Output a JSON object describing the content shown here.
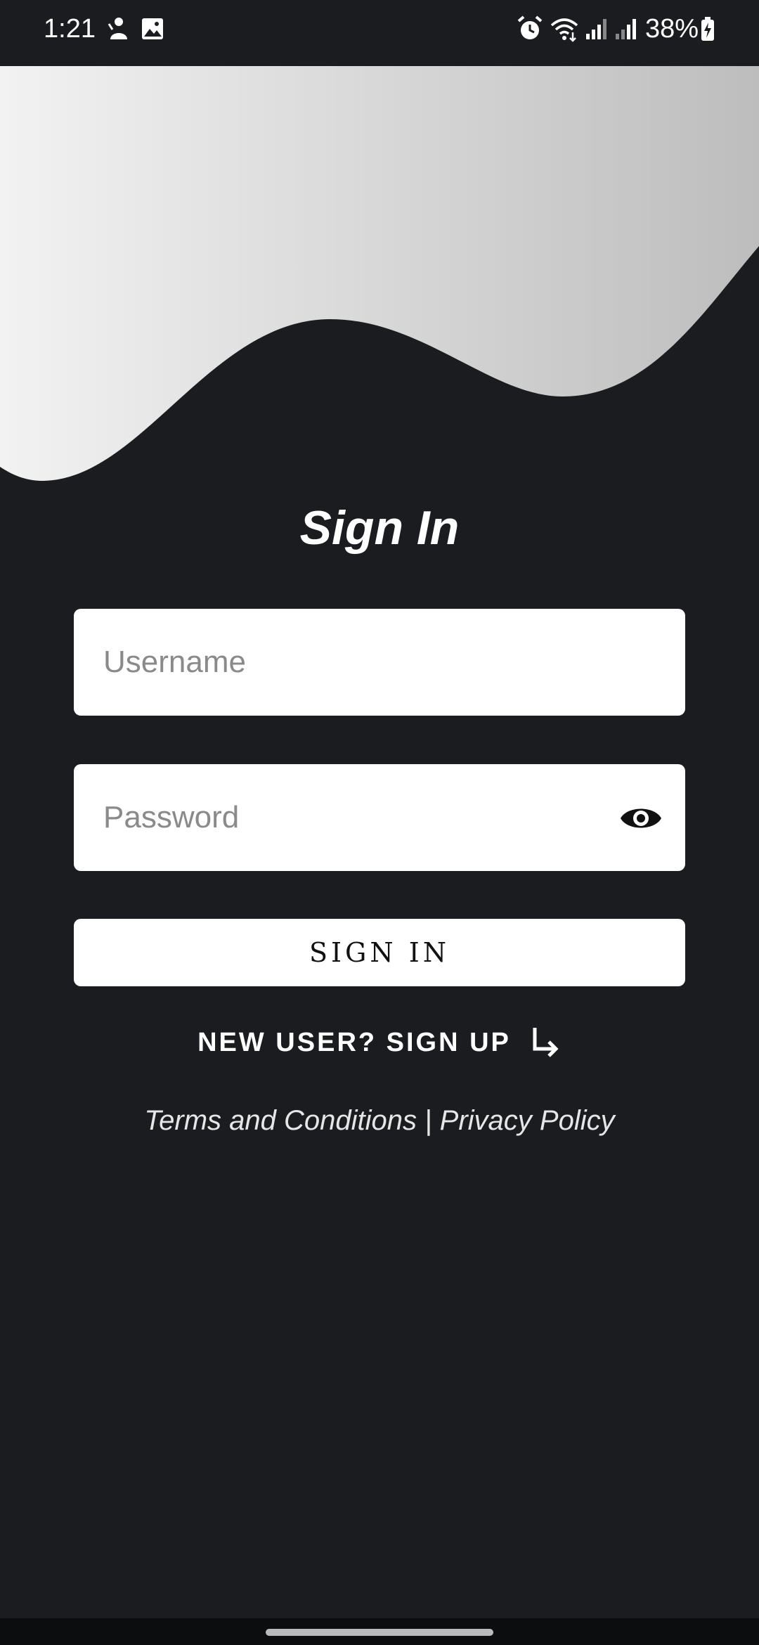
{
  "status_bar": {
    "time": "1:21",
    "battery": "38%",
    "icons": [
      "notification-person-icon",
      "gallery-icon",
      "alarm-icon",
      "wifi-icon",
      "signal-icon",
      "signal-icon",
      "battery-charging-icon"
    ]
  },
  "colors": {
    "background": "#1a1c20",
    "hero_gradient_start": "#f2f2f2",
    "hero_gradient_end": "#bdbdbd",
    "field_bg": "#ffffff"
  },
  "login": {
    "title": "Sign In",
    "username_placeholder": "Username",
    "password_placeholder": "Password",
    "signin_label": "SIGN IN",
    "signup_label": "NEW USER? SIGN UP",
    "terms_label": "Terms and Conditions",
    "separator": "|",
    "privacy_label": "Privacy Policy"
  }
}
